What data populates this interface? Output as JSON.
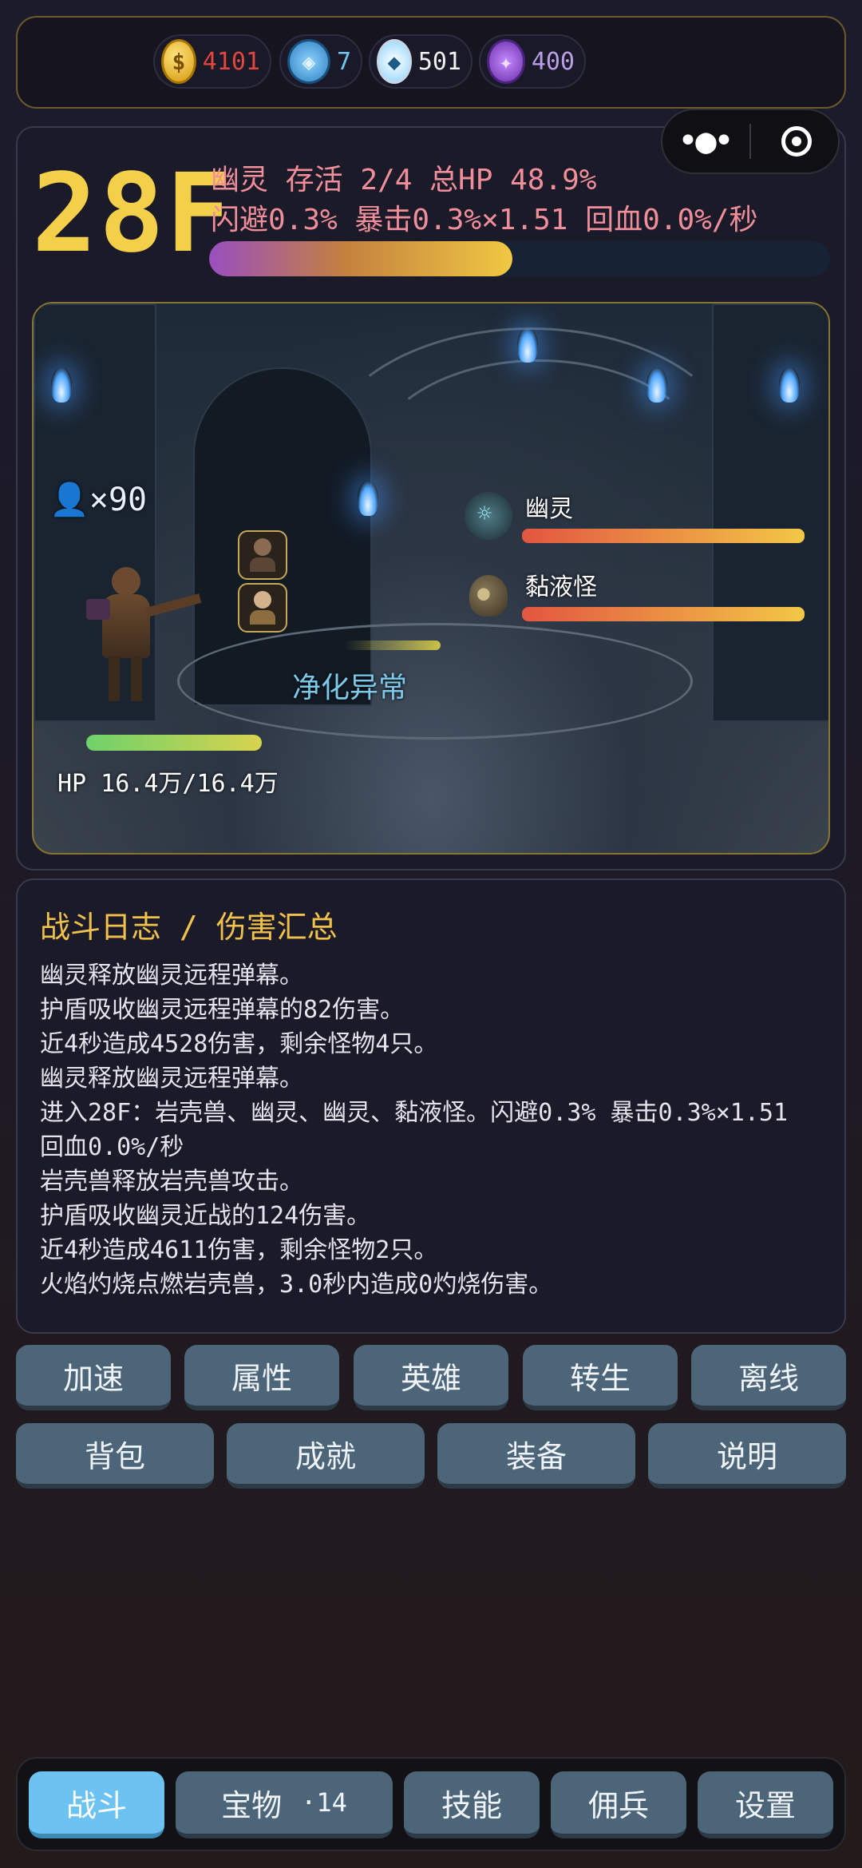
{
  "currencies": [
    {
      "icon": "gold-coin-icon",
      "value": "4101",
      "color": "#e2463f"
    },
    {
      "icon": "blue-gem-icon",
      "value": "7",
      "color": "#6fc6f5"
    },
    {
      "icon": "diamond-icon",
      "value": "501",
      "color": "#f1f1f1"
    },
    {
      "icon": "purple-crystal-icon",
      "value": "400",
      "color": "#b99ee8"
    }
  ],
  "status": {
    "floor": "28F",
    "line1": "幽灵  存活 2/4  总HP 48.9%",
    "line2": "闪避0.3%  暴击0.3%×1.51  回血0.0%/秒",
    "total_hp_fraction": 0.489
  },
  "battle": {
    "ally_count": "×90",
    "enemies": [
      {
        "name": "幽灵",
        "hp_fraction": 1.0
      },
      {
        "name": "黏液怪",
        "hp_fraction": 1.0
      }
    ],
    "skill_text": "净化异常",
    "hero_hp_text": "HP 16.4万/16.4万",
    "hero_hp_fraction": 1.0
  },
  "log": {
    "title": "战斗日志 / 伤害汇总",
    "lines": [
      "幽灵释放幽灵远程弹幕。",
      "护盾吸收幽灵远程弹幕的82伤害。",
      "近4秒造成4528伤害，剩余怪物4只。",
      "幽灵释放幽灵远程弹幕。",
      "进入28F：岩壳兽、幽灵、幽灵、黏液怪。闪避0.3%  暴击0.3%×1.51",
      "回血0.0%/秒",
      "岩壳兽释放岩壳兽攻击。",
      "护盾吸收幽灵近战的124伤害。",
      "近4秒造成4611伤害，剩余怪物2只。",
      "火焰灼烧点燃岩壳兽，3.0秒内造成0灼烧伤害。"
    ]
  },
  "actions_row1": [
    "加速",
    "属性",
    "英雄",
    "转生",
    "离线"
  ],
  "actions_row2": [
    "背包",
    "成就",
    "装备",
    "说明"
  ],
  "nav": {
    "battle": "战斗",
    "treasure": "宝物",
    "treasure_badge": "·14",
    "skills": "技能",
    "mercenary": "佣兵",
    "settings": "设置"
  }
}
